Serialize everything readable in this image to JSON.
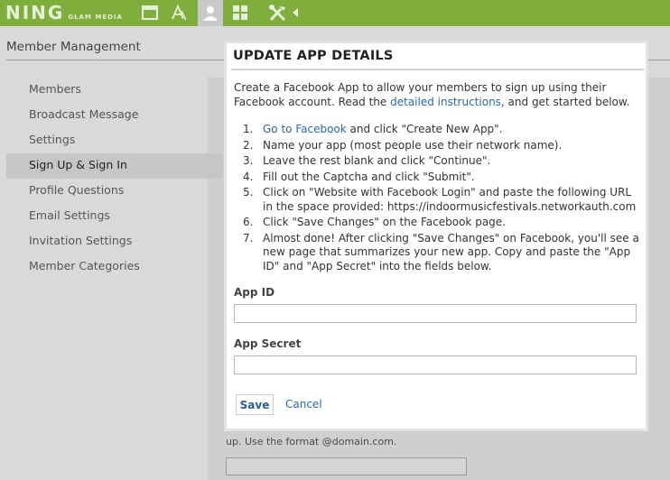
{
  "topbar": {
    "logo": "NING",
    "logo_sub": "GLAM MEDIA",
    "icons": [
      "window-icon",
      "font-icon",
      "person-icon",
      "grid-icon",
      "tools-icon",
      "arrow-left-icon"
    ],
    "color": "#7fae3c"
  },
  "page": {
    "section_title": "Member Management",
    "sidebar": [
      {
        "label": "Members"
      },
      {
        "label": "Broadcast Message"
      },
      {
        "label": "Settings"
      },
      {
        "label": "Sign Up & Sign In",
        "active": true
      },
      {
        "label": "Profile Questions"
      },
      {
        "label": "Email Settings"
      },
      {
        "label": "Invitation Settings"
      },
      {
        "label": "Member Categories"
      }
    ],
    "bg_text_bottom": "up. Use the format @domain.com."
  },
  "modal": {
    "title": "UPDATE APP DETAILS",
    "intro_1": "Create a Facebook App to allow your members to sign up using their Facebook account. Read the ",
    "intro_link": "detailed instructions",
    "intro_2": ", and get started below.",
    "steps": [
      {
        "num": "1.",
        "link": "Go to Facebook",
        "text": " and click \"Create New App\"."
      },
      {
        "num": "2.",
        "text": "Name your app (most people use their network name)."
      },
      {
        "num": "3.",
        "text": "Leave the rest blank and click \"Continue\"."
      },
      {
        "num": "4.",
        "text": "Fill out the Captcha and click \"Submit\"."
      },
      {
        "num": "5.",
        "text": "Click on \"Website with Facebook Login\" and paste the following URL in the space provided: https://indoormusicfestivals.networkauth.com"
      },
      {
        "num": "6.",
        "text": "Click \"Save Changes\" on the Facebook page."
      },
      {
        "num": "7.",
        "text": "Almost done! After clicking \"Save Changes\" on Facebook, you'll see a new page that summarizes your new app. Copy and paste the \"App ID\" and \"App Secret\" into the fields below."
      }
    ],
    "app_id_label": "App ID",
    "app_id_value": "",
    "app_secret_label": "App Secret",
    "app_secret_value": "",
    "save_label": "Save",
    "cancel_label": "Cancel"
  }
}
